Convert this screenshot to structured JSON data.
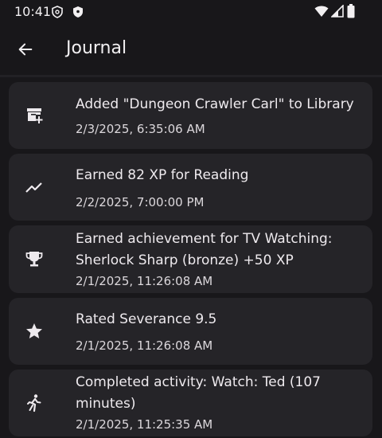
{
  "status": {
    "time": "10:41"
  },
  "header": {
    "title": "Journal"
  },
  "entries": [
    {
      "icon": "library-add-icon",
      "title": "Added \"Dungeon Crawler Carl\" to Library",
      "date": "2/3/2025, 6:35:06 AM"
    },
    {
      "icon": "trending-up-icon",
      "title": "Earned 82 XP for Reading",
      "date": "2/2/2025, 7:00:00 PM"
    },
    {
      "icon": "trophy-icon",
      "title": "Earned achievement for TV Watching: Sherlock Sharp (bronze) +50 XP",
      "date": "2/1/2025, 11:26:08 AM"
    },
    {
      "icon": "star-icon",
      "title": "Rated Severance 9.5",
      "date": "2/1/2025, 11:26:08 AM"
    },
    {
      "icon": "running-icon",
      "title": "Completed activity: Watch: Ted (107 minutes)",
      "date": "2/1/2025, 11:25:35 AM"
    }
  ]
}
